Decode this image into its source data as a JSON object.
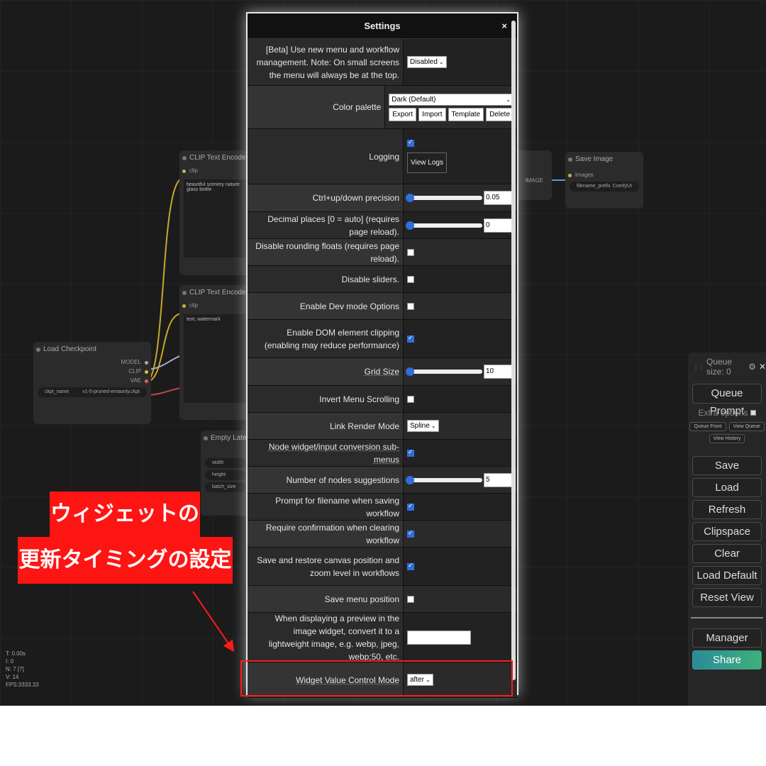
{
  "canvas": {
    "nodes": {
      "clip1": {
        "title": "CLIP Text Encode (Prompt)",
        "input": "clip",
        "text": "beautiful scenery nature glass bottle"
      },
      "clip2": {
        "title": "CLIP Text Encode (Prompt)",
        "input": "clip",
        "text": "text, watermark"
      },
      "checkpoint": {
        "title": "Load Checkpoint",
        "outputs": [
          "MODEL",
          "CLIP",
          "VAE"
        ],
        "widget_name": "ckpt_name",
        "widget_value": "v1-5-pruned-emaonly.ckpt"
      },
      "latent": {
        "title": "Empty Latent Image",
        "widgets": [
          "width",
          "height",
          "batch_size"
        ]
      },
      "save": {
        "title": "Save Image",
        "input": "images",
        "widget_name": "filename_prefix",
        "widget_value": "ComfyUI"
      },
      "decode_output": "IMAGE"
    },
    "stats": [
      "T: 0.00s",
      "I: 0",
      "N: 7 [7]",
      "V: 14",
      "FPS:3333.33"
    ]
  },
  "settings": {
    "title": "Settings",
    "close": "×",
    "rows": [
      {
        "label": "[Beta] Use new menu and workflow management. Note: On small screens the menu will always be at the top.",
        "type": "select",
        "value": "Disabled"
      },
      {
        "label": "Color palette",
        "type": "palette",
        "value": "Dark (Default)",
        "buttons": [
          "Export",
          "Import",
          "Template",
          "Delete"
        ]
      },
      {
        "label": "Logging",
        "type": "logging",
        "checked": true,
        "button": "View Logs"
      },
      {
        "label": "Ctrl+up/down precision",
        "type": "slider",
        "value": "0.05"
      },
      {
        "label": "Decimal places [0 = auto] (requires page reload).",
        "type": "slider",
        "value": "0"
      },
      {
        "label": "Disable rounding floats (requires page reload).",
        "type": "checkbox",
        "checked": false
      },
      {
        "label": "Disable sliders.",
        "type": "checkbox",
        "checked": false
      },
      {
        "label": "Enable Dev mode Options",
        "type": "checkbox",
        "checked": false
      },
      {
        "label": "Enable DOM element clipping (enabling may reduce performance)",
        "type": "checkbox",
        "checked": true
      },
      {
        "label": "Grid Size",
        "type": "slider",
        "value": "10"
      },
      {
        "label": "Invert Menu Scrolling",
        "type": "checkbox",
        "checked": false
      },
      {
        "label": "Link Render Mode",
        "type": "select",
        "value": "Spline"
      },
      {
        "label": "Node widget/input conversion sub-menus",
        "type": "checkbox",
        "checked": true
      },
      {
        "label": "Number of nodes suggestions",
        "type": "slider",
        "value": "5"
      },
      {
        "label": "Prompt for filename when saving workflow",
        "type": "checkbox",
        "checked": true
      },
      {
        "label": "Require confirmation when clearing workflow",
        "type": "checkbox",
        "checked": true
      },
      {
        "label": "Save and restore canvas position and zoom level in workflows",
        "type": "checkbox",
        "checked": true
      },
      {
        "label": "Save menu position",
        "type": "checkbox",
        "checked": false
      },
      {
        "label": "When displaying a preview in the image widget, convert it to a lightweight image, e.g. webp, jpeg, webp;50, etc.",
        "type": "text",
        "value": ""
      },
      {
        "label": "Widget Value Control Mode",
        "type": "select",
        "value": "after"
      }
    ]
  },
  "queue": {
    "size_label": "Queue size: 0",
    "queue_prompt": "Queue Prompt",
    "extra_options": "Extra options",
    "queue_front": "Queue Front",
    "view_queue": "View Queue",
    "view_history": "View History",
    "buttons": [
      "Save",
      "Load",
      "Refresh",
      "Clipspace",
      "Clear",
      "Load Default",
      "Reset View"
    ],
    "manager": "Manager",
    "share": "Share"
  },
  "annotation": {
    "line1": "ウィジェットの",
    "line2": "更新タイミングの設定",
    "color": "#ff1414"
  }
}
